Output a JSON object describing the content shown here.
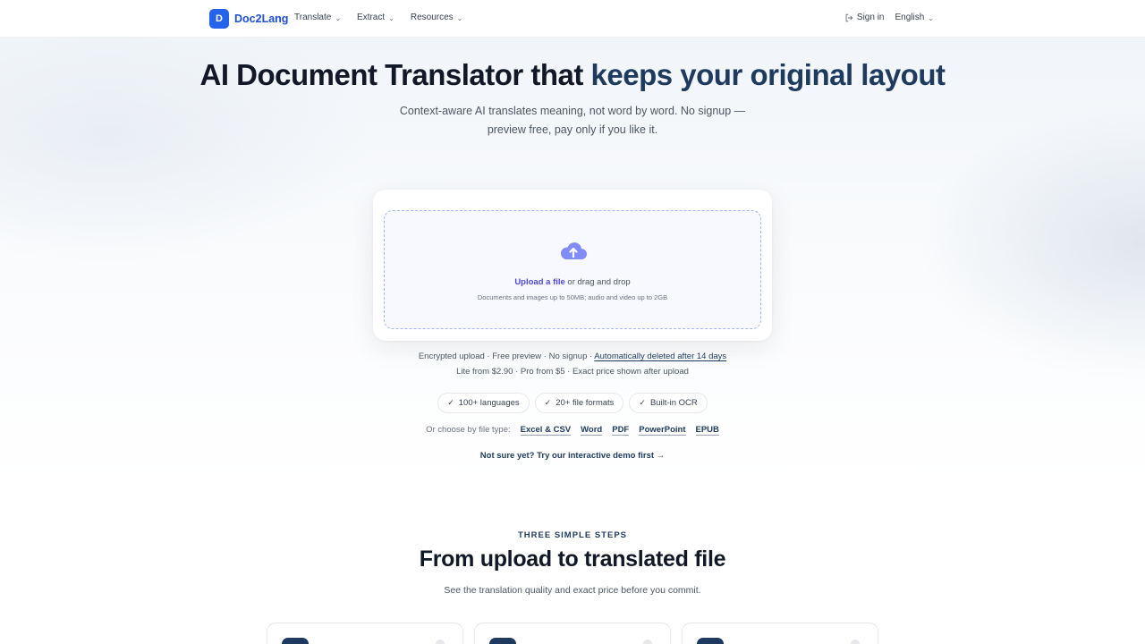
{
  "brand": {
    "logo_letter": "D",
    "name": "Doc2Lang"
  },
  "nav": {
    "items": [
      {
        "label": "Translate"
      },
      {
        "label": "Extract"
      },
      {
        "label": "Resources"
      }
    ],
    "sign_in": "Sign in",
    "language": "English"
  },
  "hero": {
    "title_plain": "AI Document Translator that ",
    "title_accent": "keeps your original layout",
    "subtitle_line1": "Context-aware AI translates meaning, not word by word. No signup —",
    "subtitle_line2": "preview free, pay only if you like it."
  },
  "upload": {
    "link_label": "Upload a file",
    "rest_label": " or drag and drop",
    "note": "Documents and images up to 50MB; audio and video up to 2GB",
    "icon": "cloud-upload-icon"
  },
  "info": {
    "line1_plain": "Encrypted upload · Free preview · No signup · ",
    "line1_link": "Automatically deleted after 14 days",
    "line2": "Lite from $2.90 · Pro from $5 · Exact price shown after upload"
  },
  "pills": [
    {
      "label": "100+ languages"
    },
    {
      "label": "20+ file formats"
    },
    {
      "label": "Built-in OCR"
    }
  ],
  "filetypes": {
    "label": "Or choose by file type:",
    "items": [
      "Excel & CSV",
      "Word",
      "PDF",
      "PowerPoint",
      "EPUB"
    ]
  },
  "demo_link": "Not sure yet? Try our interactive demo first →",
  "steps": {
    "eyebrow": "THREE SIMPLE STEPS",
    "title": "From upload to translated file",
    "subtitle": "See the translation quality and exact price before you commit."
  },
  "colors": {
    "brand": "#2563eb",
    "accent": "#1e3a5f",
    "upload_link": "#4f46e5",
    "cloud": "#818cf8"
  }
}
